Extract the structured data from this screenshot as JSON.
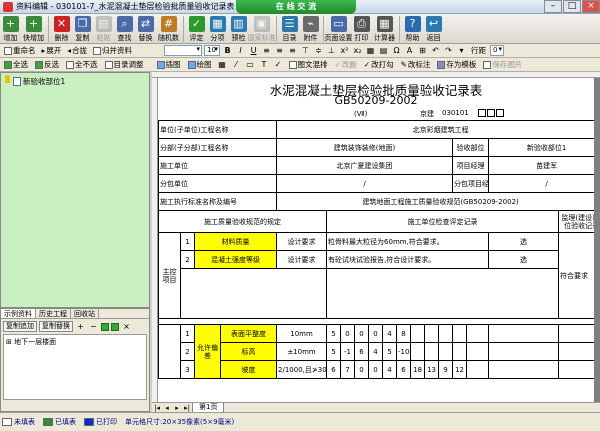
{
  "window": {
    "title": "资料编辑 - 030101-7_水泥混凝土垫层检验批质量验收记录表",
    "banner": "在 线 交 流"
  },
  "toolbar_main": [
    {
      "label": "增加",
      "icon": "plus-icon",
      "color": "#3a8a3a",
      "glyph": "+"
    },
    {
      "label": "快增加",
      "icon": "fast-add-icon",
      "color": "#3a8a3a",
      "glyph": "+"
    },
    {
      "label": "删除",
      "icon": "delete-icon",
      "color": "#cc2222",
      "glyph": "✕"
    },
    {
      "label": "复制",
      "icon": "copy-icon",
      "color": "#4a6aa8",
      "glyph": "❐"
    },
    {
      "label": "粘贴",
      "icon": "paste-icon",
      "color": "#8a8a8a",
      "glyph": "▤",
      "dim": true
    },
    {
      "label": "查找",
      "icon": "find-icon",
      "color": "#4a6aa8",
      "glyph": "⌕"
    },
    {
      "label": "替换",
      "icon": "replace-icon",
      "color": "#4a6aa8",
      "glyph": "⇄"
    },
    {
      "label": "随机数",
      "icon": "random-icon",
      "color": "#c07a20",
      "glyph": "#"
    },
    {
      "label": "评定",
      "icon": "check-icon",
      "color": "#2a9a2a",
      "glyph": "✓"
    },
    {
      "label": "分项",
      "icon": "subitem-icon",
      "color": "#2a7ab0",
      "glyph": "▦"
    },
    {
      "label": "预检",
      "icon": "precheck-icon",
      "color": "#2a7ab0",
      "glyph": "▥"
    },
    {
      "label": "国家标准",
      "icon": "standard-icon",
      "color": "#8a8a8a",
      "glyph": "▣",
      "dim": true
    },
    {
      "label": "目录",
      "icon": "catalog-icon",
      "color": "#2a7ab0",
      "glyph": "☰"
    },
    {
      "label": "附件",
      "icon": "attachment-icon",
      "color": "#6a6a6a",
      "glyph": "⌁"
    },
    {
      "label": "页面设置",
      "icon": "page-setup-icon",
      "color": "#4a6aa8",
      "glyph": "▭"
    },
    {
      "label": "打印",
      "icon": "print-icon",
      "color": "#555555",
      "glyph": "⎙"
    },
    {
      "label": "计算器",
      "icon": "calculator-icon",
      "color": "#555555",
      "glyph": "▦"
    },
    {
      "label": "帮助",
      "icon": "help-icon",
      "color": "#2a6ab0",
      "glyph": "?"
    },
    {
      "label": "返回",
      "icon": "back-icon",
      "color": "#2a7ab0",
      "glyph": "↩"
    }
  ],
  "toolbar_second": {
    "rename": "重命名",
    "expand": "展开",
    "collapse": "合拢",
    "archive": "归并资料",
    "font_size": "10",
    "spacing_label": "行距",
    "spacing_value": "0"
  },
  "toolbar_third": {
    "select_all": "全选",
    "invert": "反选",
    "none": "全不选",
    "catalog_adjust": "目录调整",
    "insert_image": "插图",
    "drawing": "绘图",
    "text_image": "图文混排",
    "rating": "改副",
    "batch_check": "改打勾",
    "batch_cross": "改标注",
    "save_template": "存为模板",
    "save_image": "保存图片"
  },
  "left_tree": {
    "item": "新验收部位1"
  },
  "left_panel": {
    "tabs": [
      "示例资料",
      "历史工程",
      "回收站"
    ],
    "buttons": [
      "复制追加",
      "复制替换"
    ],
    "list_item": "地下一层楼面"
  },
  "document": {
    "title": "水泥混凝土垫层检验批质量验收记录表",
    "subtitle": "GB50209-2002",
    "roman": "(Ⅶ)",
    "code_label": "京建",
    "code_value": "030101",
    "rows": {
      "unit_label": "单位(子单位)工程名称",
      "unit_value": "北京彩烟建筑工程",
      "sub_label": "分部(子分部)工程名称",
      "sub_value": "建筑装饰装修(地面)",
      "part_label": "验收部位",
      "part_value": "新验收部位1",
      "contractor_label": "施工单位",
      "contractor_value": "北京广夏建设集团",
      "manager_label": "项目经理",
      "manager_value": "苗建军",
      "subcon_label": "分包单位",
      "subcon_value": "/",
      "subcon_manager_label": "分包项目经理",
      "subcon_manager_value": "/",
      "standard_label": "施工执行标准名称及编号",
      "standard_value": "建筑地面工程施工质量验收规范(GB50209-2002)",
      "spec_header": "施工质量验收规范的规定",
      "check_header": "施工单位检查评定记录",
      "supervisor_header": "监理(建设)单位验收记录",
      "main_control": "主控项目",
      "item1_no": "1",
      "item1_name": "材料质量",
      "item1_req": "设计要求",
      "item1_record": "粒骨料最大粒径为60mm,符合要求。",
      "item1_mark": "选",
      "item2_no": "2",
      "item2_name": "混凝土强度等级",
      "item2_req": "设计要求",
      "item2_record": "有砼试块试验报告,符合设计要求。",
      "item2_mark": "选",
      "supervisor_record": "符合要求",
      "supervisor_mark": "选",
      "allow_label": "允许偏差",
      "dev1_no": "1",
      "dev1_name": "表面平整度",
      "dev1_std": "10mm",
      "dev1_vals": [
        "5",
        "0",
        "0",
        "0",
        "4",
        "8"
      ],
      "dev2_no": "2",
      "dev2_name": "标高",
      "dev2_std": "±10mm",
      "dev2_vals": [
        "5",
        "-1",
        "6",
        "4",
        "5",
        "-10"
      ],
      "dev3_no": "3",
      "dev3_name": "坡度",
      "dev3_std": "2/1000,且≯30mm",
      "dev3_vals": [
        "6",
        "7",
        "0",
        "0",
        "4",
        "6",
        "18",
        "13",
        "9",
        "12"
      ]
    }
  },
  "page_tabs": [
    "第1页"
  ],
  "status": [
    {
      "label": "未填表",
      "color": "#ffffff"
    },
    {
      "label": "已填表",
      "color": "#3a8a3a"
    },
    {
      "label": "已打印",
      "color": "#0033cc"
    },
    {
      "label": "单元格尺寸:20×35像素(5×9毫米)",
      "color": ""
    }
  ]
}
